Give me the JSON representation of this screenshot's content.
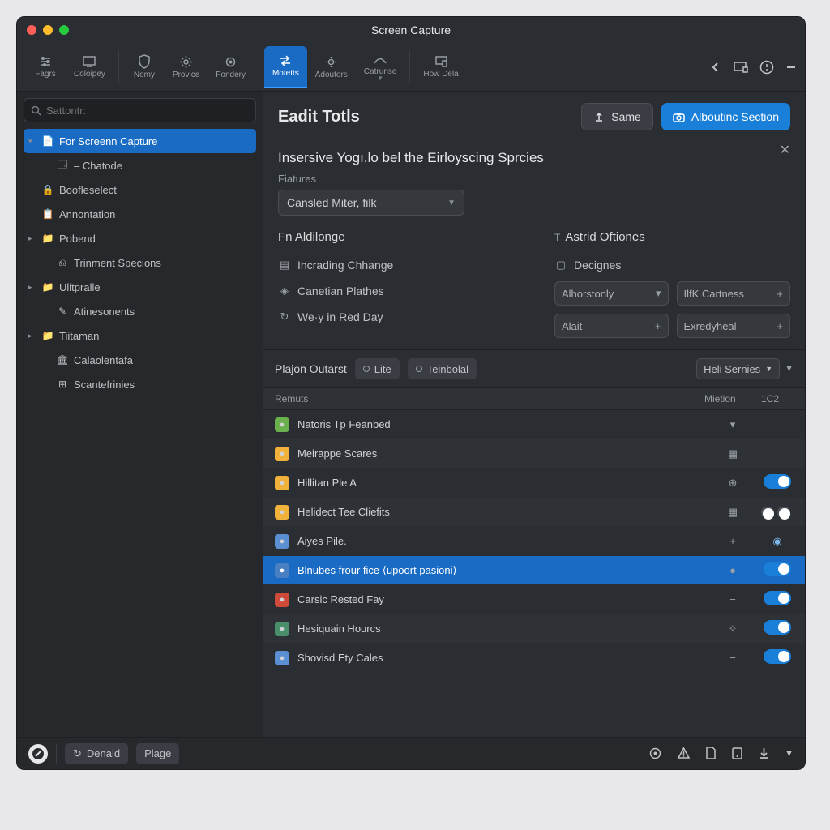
{
  "window": {
    "title": "Screen Capture"
  },
  "toolbar": {
    "groups": [
      [
        {
          "label": "Fagrs",
          "icon": "adjust"
        },
        {
          "label": "Coloipey",
          "icon": "monitor"
        }
      ],
      [
        {
          "label": "Nomy",
          "icon": "shield"
        },
        {
          "label": "Provice",
          "icon": "gear"
        },
        {
          "label": "Fondery",
          "icon": "cog"
        }
      ],
      [
        {
          "label": "Motetts",
          "icon": "swap",
          "active": true
        },
        {
          "label": "Adoutors",
          "icon": "gear2"
        },
        {
          "label": "Catrunse",
          "icon": "curve",
          "caret": true
        }
      ],
      [
        {
          "label": "How Dela",
          "icon": "device"
        }
      ]
    ]
  },
  "sidebar": {
    "search_placeholder": "Sattontr:",
    "tree": [
      {
        "label": "For Screenn Capture",
        "icon": "📄",
        "selected": true,
        "caret": "▾"
      },
      {
        "label": "– Chatode",
        "icon": "🗔",
        "child": true
      },
      {
        "label": "Boofleselect",
        "icon": "🔒"
      },
      {
        "label": "Annontation",
        "icon": "📋"
      },
      {
        "label": "Pobend",
        "icon": "📁",
        "caret": "▸"
      },
      {
        "label": "Trinment Specions",
        "icon": "⎌",
        "child": true
      },
      {
        "label": "Ulitpralle",
        "icon": "📁",
        "caret": "▸"
      },
      {
        "label": "Atinesonents",
        "icon": "✎",
        "child": true
      },
      {
        "label": "Tiitaman",
        "icon": "📁",
        "caret": "▸"
      },
      {
        "label": "Calaolentafa",
        "icon": "🏛",
        "child": true
      },
      {
        "label": "Scantefrinies",
        "icon": "⊞",
        "child": true
      }
    ]
  },
  "main": {
    "title": "Eadit Totls",
    "same_button": "Same",
    "primary_button": "Alboutinc Section",
    "section_title": "Insersive Yogı.lo bel the Eirloyscing Sprcies",
    "features_label": "Fiatures",
    "dropdown_value": "Cansled Miter, filk",
    "left_col_title": "Fn Aldilonge",
    "left_opts": [
      {
        "label": "Incrading Chhange",
        "icon": "▤"
      },
      {
        "label": "Canetian Plathes",
        "icon": "◈"
      },
      {
        "label": "We·y in Red Day",
        "icon": "↻"
      }
    ],
    "right_col_title": "Astrid Oftiones",
    "right_opt": {
      "label": "Decignes",
      "icon": "▢"
    },
    "fields": [
      {
        "value": "Alhorstonly",
        "suffix": "▾"
      },
      {
        "value": "IlfK Cartness",
        "suffix": "+"
      },
      {
        "value": "Alait",
        "suffix": "+"
      },
      {
        "value": "Exredyheal",
        "suffix": "+"
      }
    ]
  },
  "panel": {
    "title": "Plajon Outarst",
    "chips": [
      {
        "label": "Lite"
      },
      {
        "label": "Teinbolal"
      }
    ],
    "selector": "Heli Sernies",
    "columns": {
      "name": "Remuts",
      "m": "Mietion",
      "c": "1C2"
    },
    "rows": [
      {
        "label": "Natoris Tp Feanbed",
        "icon_bg": "#6ab04c",
        "m": "▾",
        "toggle": null
      },
      {
        "label": "Meirappe Scares",
        "icon_bg": "#f0b23a",
        "m": "▦",
        "toggle": null,
        "alt": true
      },
      {
        "label": "Hillitan Ple A",
        "icon_bg": "#f0b23a",
        "m": "⊕",
        "toggle": "on"
      },
      {
        "label": "Helidect Tee Cliefits",
        "icon_bg": "#f0b23a",
        "m": "▦",
        "toggle": "double",
        "alt": true
      },
      {
        "label": "Aiyes Pile.",
        "icon_bg": "#5a8fd4",
        "m": "+",
        "toggle": "eye"
      },
      {
        "label": "Blnubes frour fice ⟨upoort pasioni⟩",
        "icon_bg": "#4a7fc4",
        "m": "●",
        "toggle": "on",
        "selected": true
      },
      {
        "label": "Carsic Rested Fay",
        "icon_bg": "#d04a3a",
        "m": "−",
        "toggle": "on"
      },
      {
        "label": "Hesiquain Hourcs",
        "icon_bg": "#4a8f6c",
        "m": "✧",
        "toggle": "on",
        "alt": true
      },
      {
        "label": "Shovisd Ety Cales",
        "icon_bg": "#5a8fd4",
        "m": "−",
        "toggle": "on"
      }
    ]
  },
  "statusbar": {
    "pill1": "Denald",
    "pill2": "Plage"
  }
}
